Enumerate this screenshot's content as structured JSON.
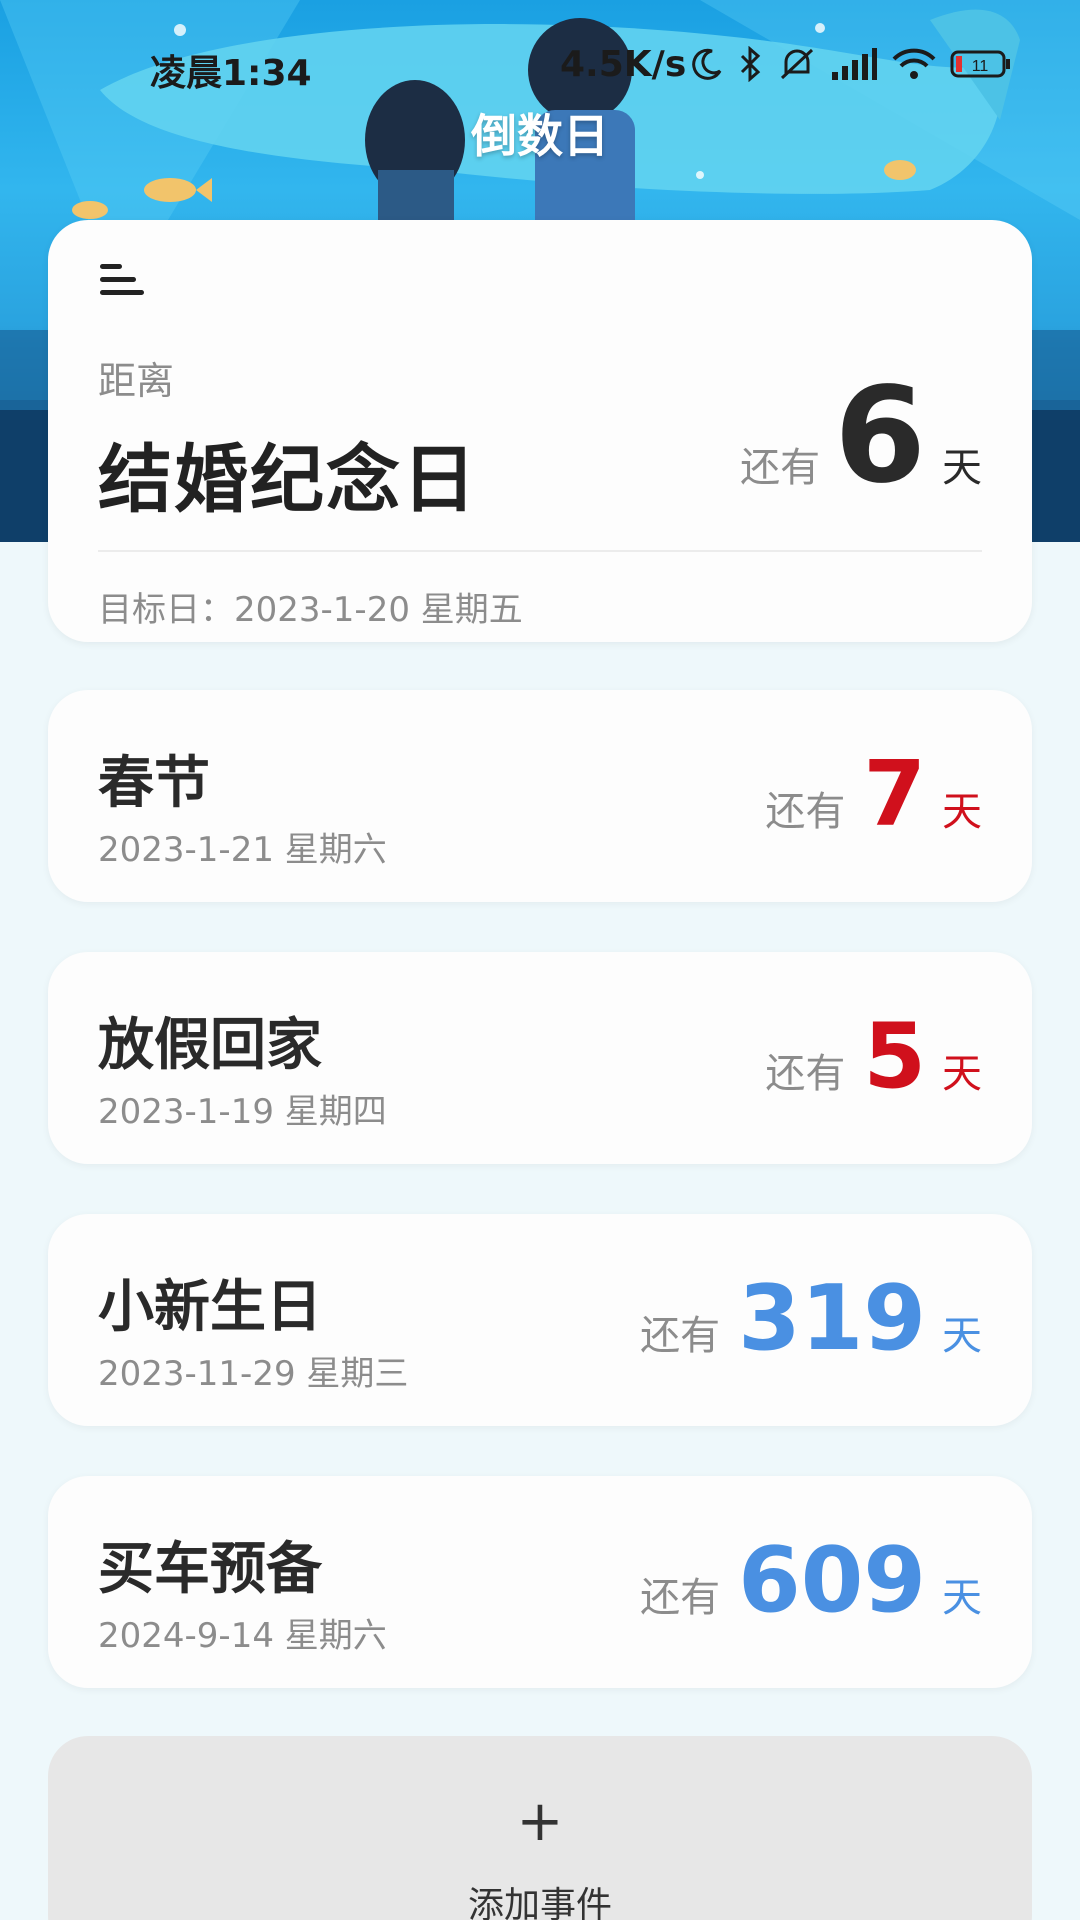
{
  "status_bar": {
    "time": "凌晨1:34",
    "speed": "4.5K/s",
    "battery": "11",
    "icons": [
      "moon-icon",
      "bluetooth-icon",
      "mute-icon",
      "signal-icon",
      "wifi-icon",
      "battery-icon"
    ]
  },
  "header": {
    "title": "倒数日"
  },
  "featured": {
    "label": "距离",
    "name": "结婚纪念日",
    "prefix": "还有",
    "days": "6",
    "unit": "天",
    "target": "目标日：2023-1-20 星期五"
  },
  "events": [
    {
      "name": "春节",
      "date": "2023-1-21 星期六",
      "prefix": "还有",
      "days": "7",
      "unit": "天",
      "color": "#d0101c"
    },
    {
      "name": "放假回家",
      "date": "2023-1-19 星期四",
      "prefix": "还有",
      "days": "5",
      "unit": "天",
      "color": "#d0101c"
    },
    {
      "name": "小新生日",
      "date": "2023-11-29 星期三",
      "prefix": "还有",
      "days": "319",
      "unit": "天",
      "color": "#4a90e2"
    },
    {
      "name": "买车预备",
      "date": "2024-9-14 星期六",
      "prefix": "还有",
      "days": "609",
      "unit": "天",
      "color": "#4a90e2"
    }
  ],
  "add_button": {
    "plus": "+",
    "label": "添加事件"
  },
  "colors": {
    "accent_red": "#d0101c",
    "accent_blue": "#4a90e2",
    "background": "#eef8fb"
  }
}
